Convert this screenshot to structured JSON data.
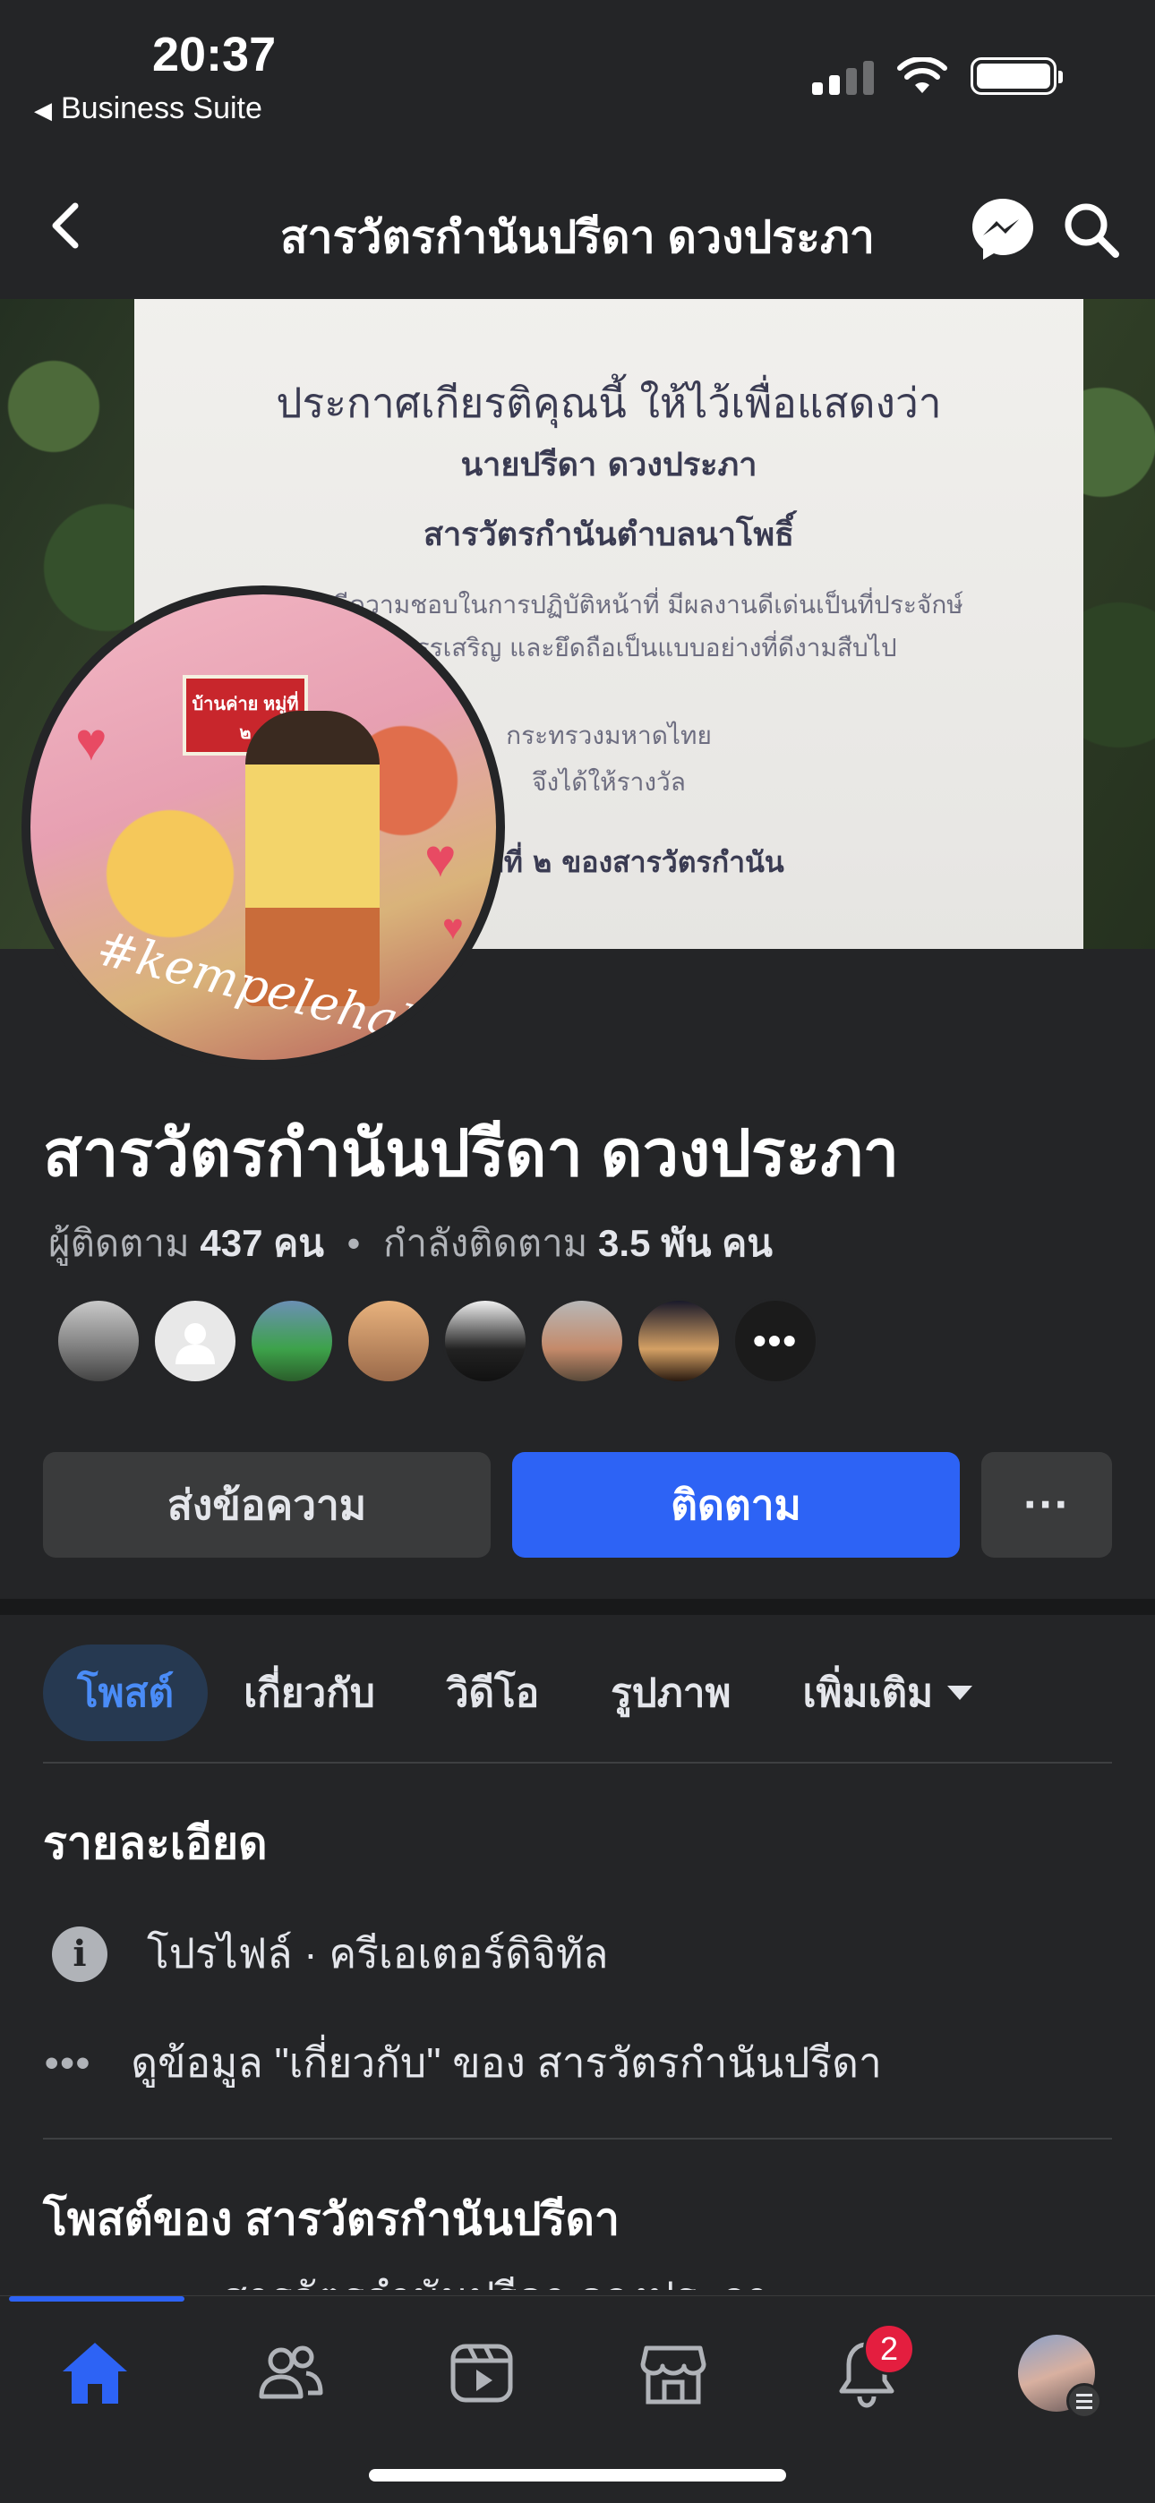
{
  "status_bar": {
    "time": "20:37",
    "back_app": "Business Suite",
    "icons": [
      "signal-icon",
      "wifi-icon",
      "battery-icon"
    ]
  },
  "header": {
    "title": "สารวัตรกำนันปรีดา ดวงประภา",
    "icons": [
      "back-chevron-icon",
      "messenger-icon",
      "search-icon"
    ]
  },
  "cover": {
    "certificate_lines": [
      "ประกาศเกียรติคุณนี้ ให้ไว้เพื่อแสดงว่า",
      "นายปรีดา  ดวงประภา",
      "สารวัตรกำนันตำบลนาโพธิ์",
      "มีความดีความชอบในการปฏิบัติหน้าที่ มีผลงานดีเด่นเป็นที่ประจักษ์",
      "ยกย่อง สรรเสริญ และยึดถือเป็นแบบอย่างที่ดีงามสืบไป",
      "กระทรวงมหาดไทย",
      "จึงได้ให้รางวัล",
      "ลำดับที่ ๒ ของสารวัตรกำนัน"
    ]
  },
  "avatar": {
    "sign_text": "บ้านค่าย หมู่ที่ ๒",
    "hashtag": "#kempelehalii"
  },
  "profile": {
    "name": "สารวัตรกำนันปรีดา ดวงประภา",
    "followers_label": "ผู้ติดตาม",
    "followers_count": "437 คน",
    "following_label": "กำลังติดตาม",
    "following_count": "3.5 พัน คน",
    "separator": "•"
  },
  "actions": {
    "message": "ส่งข้อความ",
    "follow": "ติดตาม",
    "more": "···"
  },
  "tabs": [
    {
      "label": "โพสต์",
      "active": true
    },
    {
      "label": "เกี่ยวกับ",
      "active": false
    },
    {
      "label": "วิดีโอ",
      "active": false
    },
    {
      "label": "รูปภาพ",
      "active": false
    },
    {
      "label": "เพิ่มเติม",
      "active": false
    }
  ],
  "details": {
    "heading": "รายละเอียด",
    "profile_type": "โปรไฟล์ · ครีเอเตอร์ดิจิทัล",
    "about_link": "ดูข้อมูล \"เกี่ยวกับ\" ของ สารวัตรกำนันปรีดา"
  },
  "posts": {
    "heading": "โพสต์ของ สารวัตรกำนันปรีดา",
    "peek": "สารวัตรกำนันปรีดา ดวงประภา"
  },
  "bottom_nav": {
    "items": [
      "home-icon",
      "friends-icon",
      "video-icon",
      "marketplace-icon",
      "notifications-icon",
      "profile-menu"
    ],
    "notification_count": "2"
  },
  "colors": {
    "background": "#242527",
    "accent": "#2d63f5",
    "active_tab_bg": "#263951",
    "badge": "#e41e3f"
  }
}
